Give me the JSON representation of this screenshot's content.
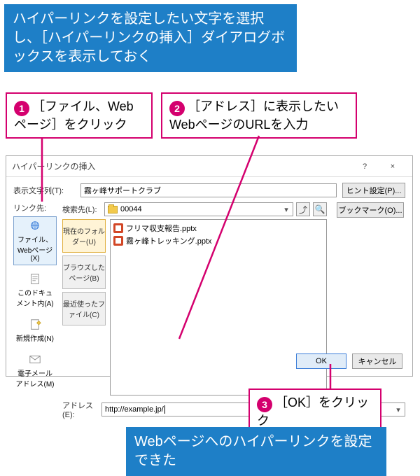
{
  "intro": "ハイパーリンクを設定したい文字を選択し、［ハイパーリンクの挿入］ダイアログボックスを表示しておく",
  "callouts": {
    "c1": "［ファイル、Webページ］をクリック",
    "c2": "［アドレス］に表示したいWebページのURLを入力",
    "c3": "［OK］をクリック"
  },
  "result": "Webページへのハイパーリンクを設定できた",
  "dialog": {
    "title": "ハイパーリンクの挿入",
    "help": "?",
    "close": "×",
    "link_to_label": "リンク先:",
    "display_text_label": "表示文字列(T):",
    "display_text_value": "霧ヶ峰サポートクラブ",
    "hint_button": "ヒント設定(P)...",
    "bookmark_button": "ブックマーク(O)...",
    "search_label": "検索先(L):",
    "search_value": "00044",
    "tabs": {
      "current": "現在のフォルダー(U)",
      "browsed": "ブラウズしたページ(B)",
      "recent": "最近使ったファイル(C)"
    },
    "linkto": {
      "file_web": "ファイル、Webページ(X)",
      "this_doc": "このドキュメント内(A)",
      "new_doc": "新規作成(N)",
      "email": "電子メール アドレス(M)"
    },
    "files": [
      "フリマ収支報告.pptx",
      "霧ヶ峰トレッキング.pptx"
    ],
    "address_label": "アドレス(E):",
    "address_value": "http://example.jp/",
    "ok": "OK",
    "cancel": "キャンセル"
  }
}
